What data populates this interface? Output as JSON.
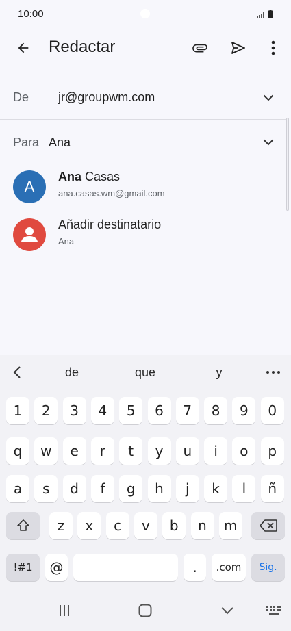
{
  "status": {
    "time": "10:00"
  },
  "app_bar": {
    "title": "Redactar"
  },
  "from": {
    "label": "De",
    "value": "jr@groupwm.com"
  },
  "to": {
    "label": "Para",
    "value": "Ana"
  },
  "suggestions": [
    {
      "initial": "A",
      "name_bold": "Ana",
      "name_rest": " Casas",
      "sub": "ana.casas.wm@gmail.com",
      "color": "#2a6fb5"
    },
    {
      "name": "Añadir destinatario",
      "sub": "Ana",
      "color": "#e04a3f"
    }
  ],
  "keyboard": {
    "word_suggestions": [
      "de",
      "que",
      "y"
    ],
    "row1": [
      "1",
      "2",
      "3",
      "4",
      "5",
      "6",
      "7",
      "8",
      "9",
      "0"
    ],
    "row2": [
      "q",
      "w",
      "e",
      "r",
      "t",
      "y",
      "u",
      "i",
      "o",
      "p"
    ],
    "row3": [
      "a",
      "s",
      "d",
      "f",
      "g",
      "h",
      "j",
      "k",
      "l",
      "ñ"
    ],
    "row4": [
      "z",
      "x",
      "c",
      "v",
      "b",
      "n",
      "m"
    ],
    "symbols": "!#1",
    "at": "@",
    "period": ".",
    "dotcom": ".com",
    "go": "Sig."
  },
  "colors": {
    "accent": "#1a73e8",
    "avatar_blue": "#2a6fb5",
    "avatar_red": "#e04a3f"
  }
}
